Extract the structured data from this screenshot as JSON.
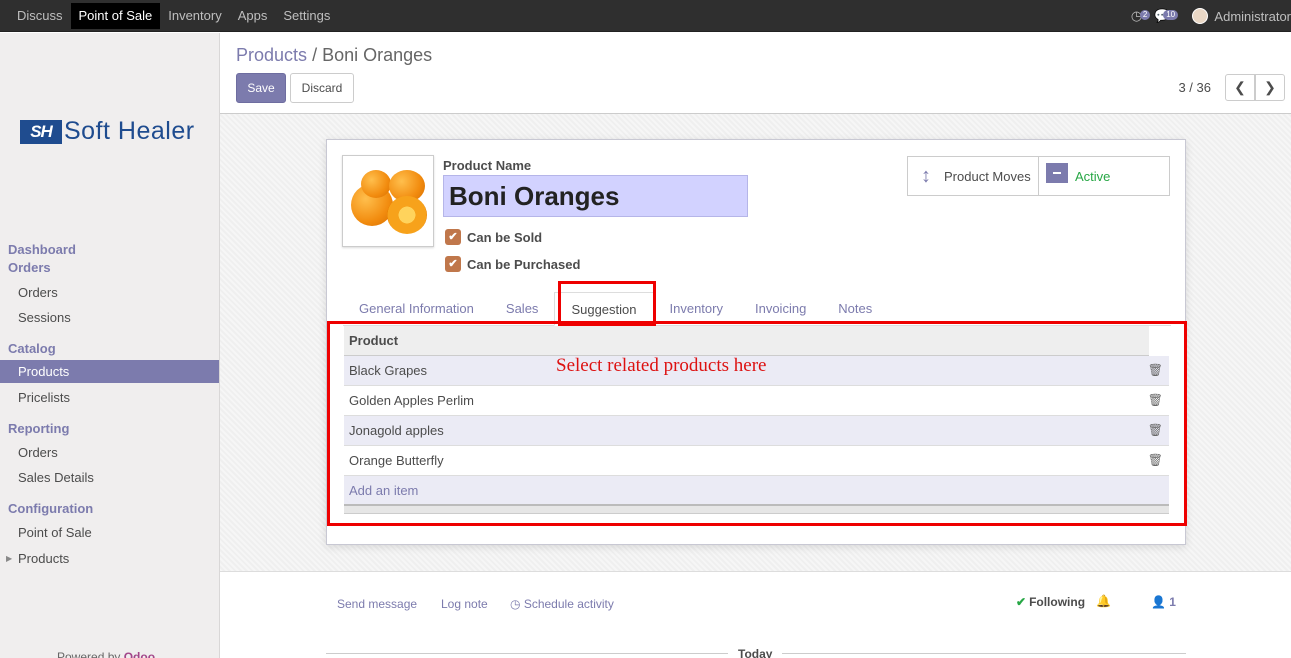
{
  "topbar": {
    "menu": [
      "Discuss",
      "Point of Sale",
      "Inventory",
      "Apps",
      "Settings"
    ],
    "active_menu": "Point of Sale",
    "activity_badge": "2",
    "messages_badge": "10",
    "user": "Administrator"
  },
  "sidebar": {
    "logo_mark": "SH",
    "logo_text": "Soft Healer",
    "sections": {
      "dashboard": "Dashboard",
      "orders": "Orders",
      "catalog": "Catalog",
      "reporting": "Reporting",
      "configuration": "Configuration"
    },
    "items": {
      "orders": "Orders",
      "sessions": "Sessions",
      "products": "Products",
      "pricelists": "Pricelists",
      "rep_orders": "Orders",
      "sales_details": "Sales Details",
      "point_of_sale": "Point of Sale",
      "config_products": "Products"
    },
    "powered_by": "Powered by",
    "powered_brand": "Odoo"
  },
  "control": {
    "breadcrumb_parent": "Products",
    "breadcrumb_sep": "/",
    "breadcrumb_current": "Boni Oranges",
    "save_label": "Save",
    "discard_label": "Discard",
    "pager": "3 / 36"
  },
  "form": {
    "product_name_label": "Product Name",
    "product_name_value": "Boni Oranges",
    "can_be_sold": "Can be Sold",
    "can_be_purchased": "Can be Purchased",
    "stat_moves": "Product Moves",
    "stat_active": "Active",
    "tabs": [
      "General Information",
      "Sales",
      "Suggestion",
      "Inventory",
      "Invoicing",
      "Notes"
    ],
    "active_tab": "Suggestion",
    "grid_header": "Product",
    "grid_rows": [
      "Black Grapes",
      "Golden Apples Perlim",
      "Jonagold apples",
      "Orange Butterfly"
    ],
    "add_item": "Add an item",
    "annotation": "Select related products here"
  },
  "chatter": {
    "send_message": "Send message",
    "log_note": "Log note",
    "schedule_activity": "Schedule activity",
    "following": "Following",
    "followers_count": "1",
    "today": "Today"
  },
  "colors": {
    "brand": "#7c7bad",
    "highlight": "#ee0000",
    "active_green": "#27a745"
  }
}
